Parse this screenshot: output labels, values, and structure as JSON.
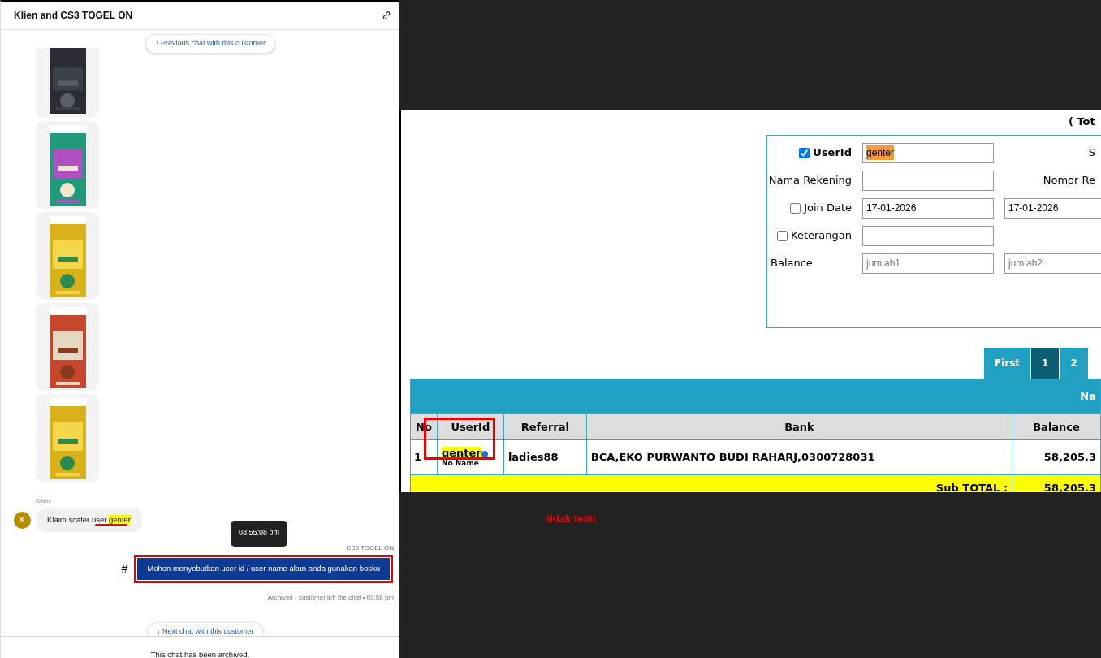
{
  "chat": {
    "title": "Klien and CS3 TOGEL ON",
    "prev_icon": "↑",
    "prev_button": "Previous chat with this customer",
    "customer": {
      "name": "Klien",
      "initial": "K",
      "text": "Klaim scater user ",
      "highlighted": "genter"
    },
    "tooltip": "03:55:08 pm",
    "agent": {
      "name": "CS3 TOGEL ON",
      "mark": "#",
      "text": "Mohon menyebutkan user id / user name akun anda gunakan bosku"
    },
    "status": "Archived - customer left the chat • 03:58 pm",
    "next_icon": "↓",
    "next_button": "Next chat with this customer",
    "footer": "This chat has been archived."
  },
  "admin": {
    "heading": "( Tot",
    "filters": [
      {
        "kind": "check",
        "label": "UserId",
        "checked": true,
        "value": "genter",
        "right_label": "S"
      },
      {
        "kind": "plain",
        "label": "Nama Rekening",
        "right_label": "Nomor Re"
      },
      {
        "kind": "check",
        "label": "Join Date",
        "checked": false,
        "value": "17-01-2026",
        "value2": "17-01-2026"
      },
      {
        "kind": "check",
        "label": "Keterangan",
        "checked": false
      },
      {
        "kind": "plain",
        "label": "Balance",
        "placeholder": "jumlah1",
        "placeholder2": "jumlah2"
      }
    ],
    "pagination": [
      {
        "label": "First",
        "selected": false
      },
      {
        "label": "1",
        "selected": true
      },
      {
        "label": "2",
        "selected": false
      }
    ],
    "table": {
      "band": "Na",
      "columns": [
        "No",
        "UserId",
        "Referral",
        "Bank",
        "Balance"
      ],
      "rows": [
        {
          "no": "1",
          "userid": "genter",
          "subname": "No Name",
          "referral": "ladies88",
          "bank": "BCA,EKO PURWANTO BUDI RAHARJ,0300728031",
          "balance": "58,205.3"
        }
      ],
      "subtotal_label": "Sub TOTAL :",
      "subtotal": "58,205.3"
    }
  },
  "annotation": "tidak teliti"
}
